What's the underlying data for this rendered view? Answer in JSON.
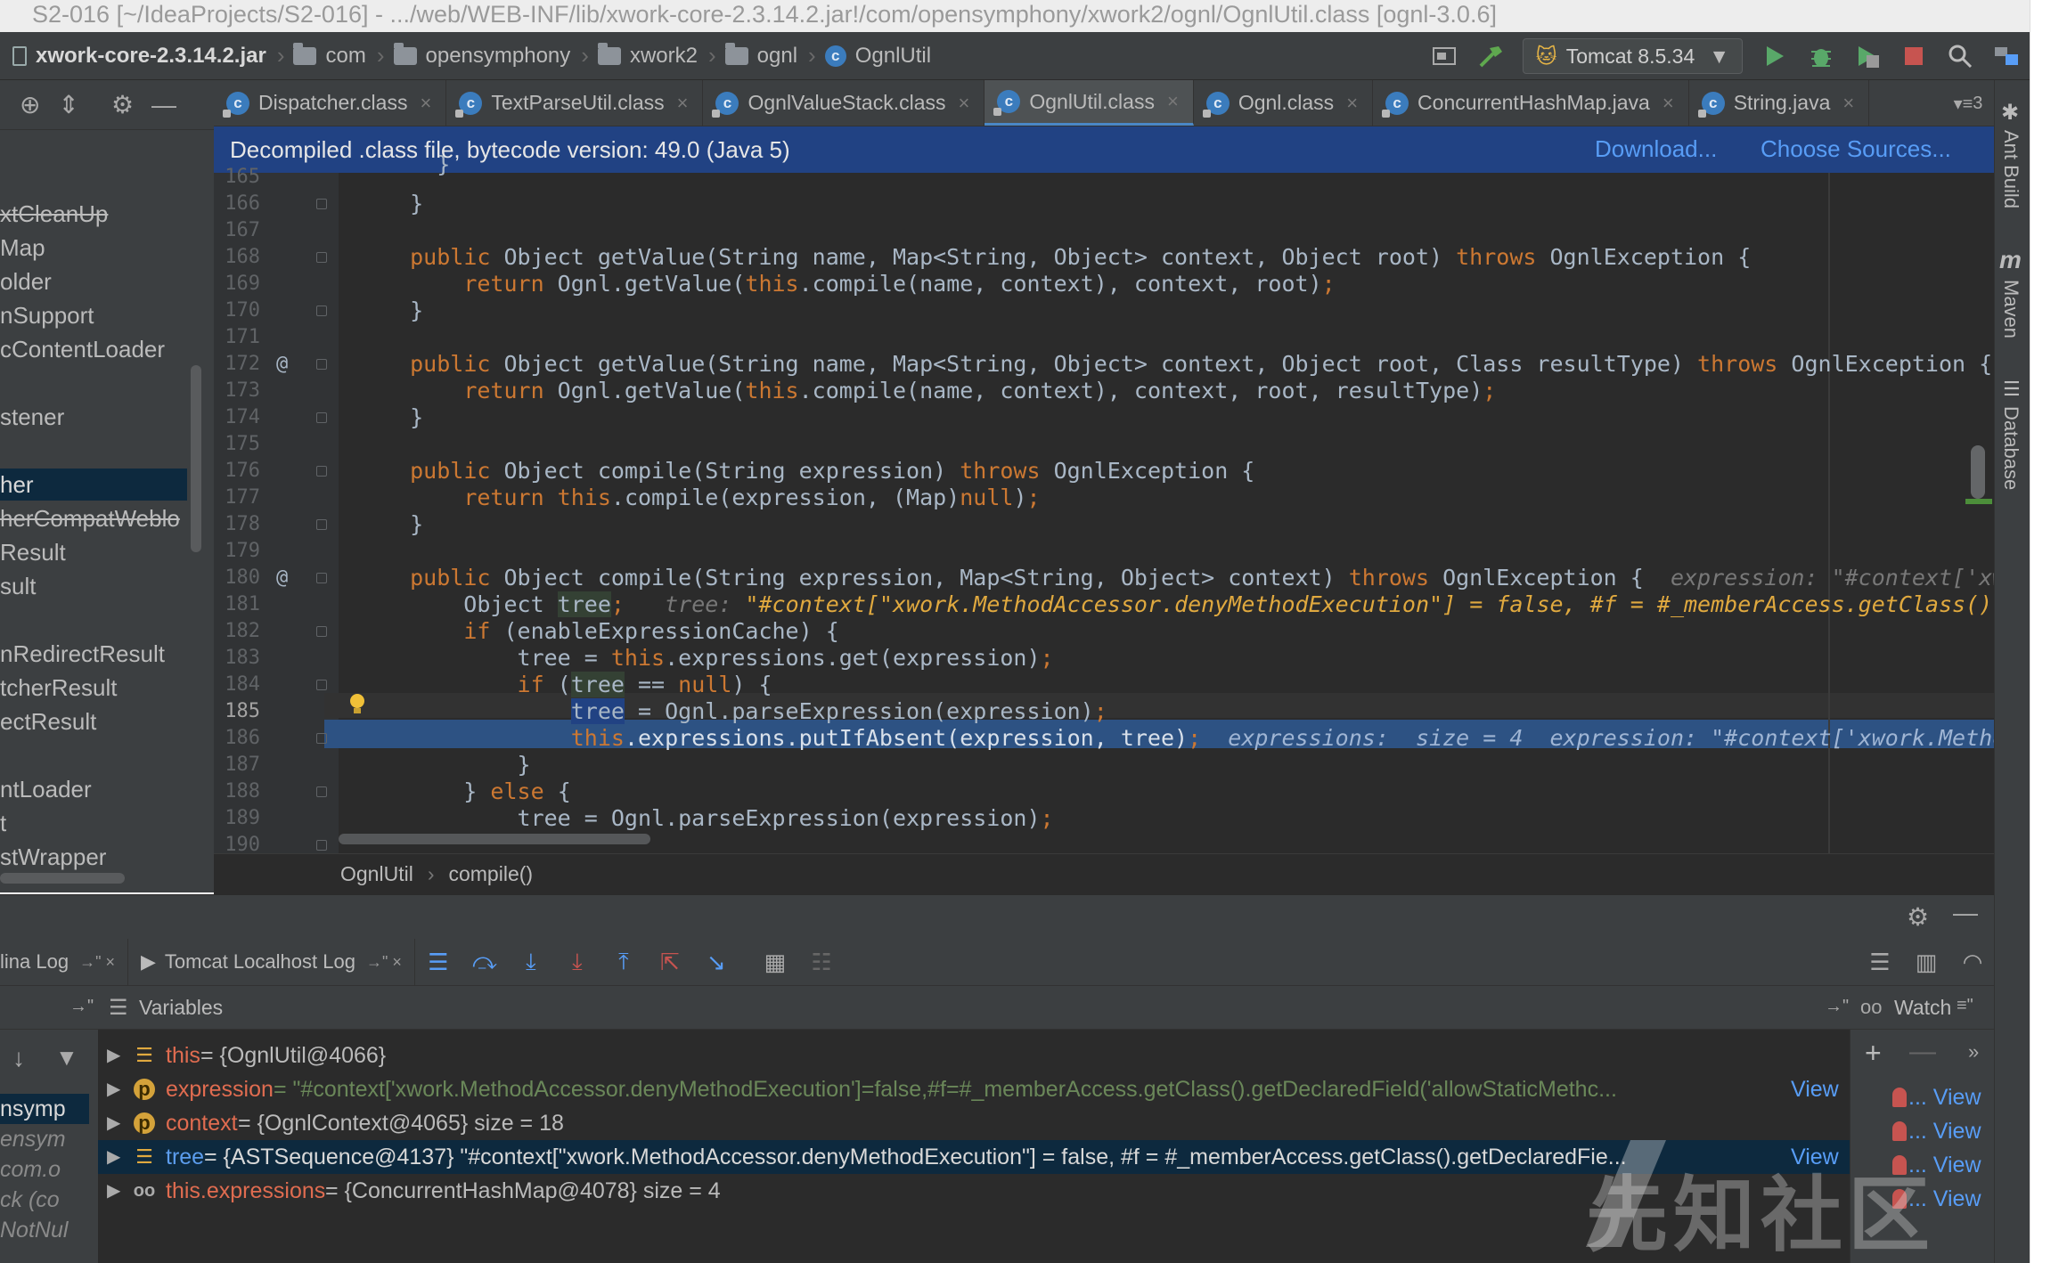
{
  "window": {
    "title": "S2-016 [~/IdeaProjects/S2-016] - .../web/WEB-INF/lib/xwork-core-2.3.14.2.jar!/com/opensymphony/xwork2/ognl/OgnlUtil.class [ognl-3.0.6]"
  },
  "navbar": {
    "crumbs": [
      "xwork-core-2.3.14.2.jar",
      "com",
      "opensymphony",
      "xwork2",
      "ognl",
      "OgnlUtil"
    ],
    "run_config": "Tomcat 8.5.34"
  },
  "project": {
    "items": [
      {
        "label": "xtCleanUp",
        "strike": true
      },
      {
        "label": "Map"
      },
      {
        "label": "older"
      },
      {
        "label": "nSupport"
      },
      {
        "label": "cContentLoader"
      },
      {
        "label": "stener"
      },
      {
        "label": "her",
        "selected": true
      },
      {
        "label": "herCompatWeblo",
        "strike": true
      },
      {
        "label": "Result"
      },
      {
        "label": "sult"
      },
      {
        "label": "nRedirectResult"
      },
      {
        "label": "tcherResult"
      },
      {
        "label": "ectResult"
      },
      {
        "label": "ntLoader"
      },
      {
        "label": "t"
      },
      {
        "label": "stWrapper"
      }
    ]
  },
  "tabs": [
    {
      "label": "Dispatcher.class"
    },
    {
      "label": "TextParseUtil.class"
    },
    {
      "label": "OgnlValueStack.class"
    },
    {
      "label": "OgnlUtil.class",
      "active": true
    },
    {
      "label": "Ognl.class"
    },
    {
      "label": "ConcurrentHashMap.java"
    },
    {
      "label": "String.java"
    }
  ],
  "tabs_more": "3",
  "banner": {
    "text": "Decompiled .class file, bytecode version: 49.0 (Java 5)",
    "download": "Download...",
    "choose_sources": "Choose Sources..."
  },
  "editor": {
    "lines": [
      "165",
      "166",
      "167",
      "168",
      "169",
      "170",
      "171",
      "172",
      "173",
      "174",
      "175",
      "176",
      "177",
      "178",
      "179",
      "180",
      "181",
      "182",
      "183",
      "184",
      "185",
      "186",
      "187",
      "188",
      "189",
      "190"
    ],
    "annotations": {
      "172": "@",
      "180": "@"
    },
    "inline_values": {
      "l180": "expression: \"#context['xwork.Method",
      "l181_tree": "tree: ",
      "l181_value": "\"#context[\"xwork.MethodAccessor.denyMethodExecution\"] = false, #f = #_memberAccess.getClass().getDeclared",
      "l186": "expressions:  size = 4  expression: \"#context['xwork.MethodAccessor."
    }
  },
  "breadcrumb": {
    "class": "OgnlUtil",
    "method": "compile()"
  },
  "right_stripe": {
    "ant": "Ant Build",
    "maven": "Maven",
    "database": "Database"
  },
  "debug": {
    "tabs": [
      "lina Log",
      "Tomcat Localhost Log"
    ],
    "variables_title": "Variables",
    "watches_title": "Watch",
    "frames": [
      {
        "label": "nsymp",
        "selected": true
      },
      {
        "label": "ensym",
        "italic": true
      },
      {
        "label": "com.o",
        "italic": true
      },
      {
        "label": "ck (co",
        "italic": true
      },
      {
        "label": "NotNul",
        "italic": true
      }
    ],
    "variables": [
      {
        "name": "this",
        "value": " = {OgnlUtil@4066}"
      },
      {
        "name": "expression",
        "value": " = \"#context['xwork.MethodAccessor.denyMethodExecution']=false,#f=#_memberAccess.getClass().getDeclaredField('allowStaticMethc...",
        "view": "View"
      },
      {
        "name": "context",
        "value": " = {OgnlContext@4065}  size = 18"
      },
      {
        "name": "tree",
        "value": " = {ASTSequence@4137} \"#context[\"xwork.MethodAccessor.denyMethodExecution\"] = false, #f = #_memberAccess.getClass().getDeclaredFie...",
        "view": "View"
      },
      {
        "name": "this.expressions",
        "value": " = {ConcurrentHashMap@4078}  size = 4"
      }
    ],
    "watch_rows": [
      "... View",
      "... View",
      "... View",
      "... View"
    ]
  },
  "watermark": "先知社区",
  "colors": {
    "keyword": "#cc7832",
    "string": "#6a8759",
    "selection": "#2d5283",
    "accent": "#4a88c7"
  }
}
